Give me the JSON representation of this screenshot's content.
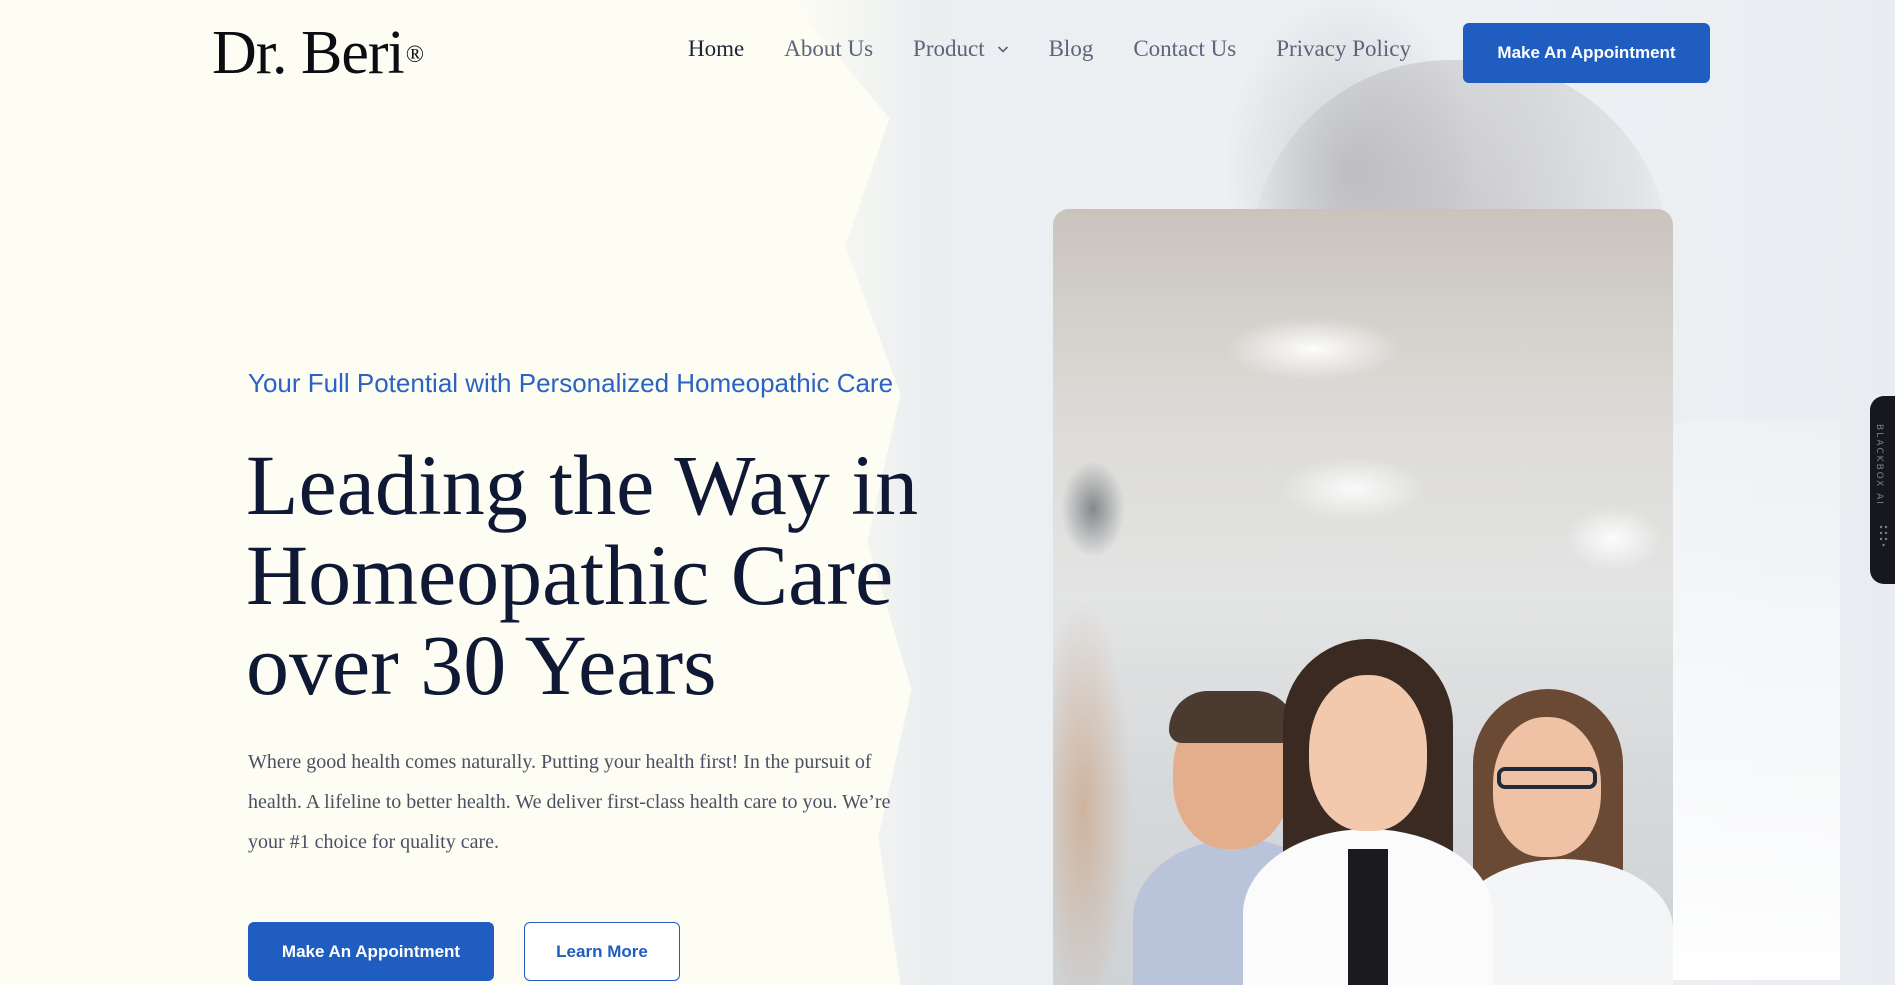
{
  "logo": {
    "text": "Dr. Beri",
    "mark": "®"
  },
  "nav": {
    "items": [
      {
        "label": "Home",
        "active": true
      },
      {
        "label": "About Us"
      },
      {
        "label": "Product",
        "has_dropdown": true,
        "icon": "chevron-down-icon"
      },
      {
        "label": "Blog"
      },
      {
        "label": "Contact Us"
      },
      {
        "label": "Privacy Policy"
      }
    ],
    "cta_label": "Make An Appointment"
  },
  "hero": {
    "tagline": "Your Full Potential with Personalized Homeopathic Care",
    "headline": "Leading the Way in Homeopathic Care over 30 Years",
    "description": "Where good health comes naturally. Putting your health first! In the pursuit of health. A lifeline to better health. We deliver first-class health care to you. We’re your #1 choice for quality care.",
    "primary_cta": "Make An Appointment",
    "secondary_cta": "Learn More",
    "image": "doctors-team-photo"
  },
  "side_widget": {
    "label": "BLACKBOX AI"
  },
  "colors": {
    "accent": "#1f5dc1",
    "tagline": "#2a63c4",
    "heading": "#0f1834",
    "background": "#fdfdf3",
    "nav_text": "#5b6478"
  }
}
